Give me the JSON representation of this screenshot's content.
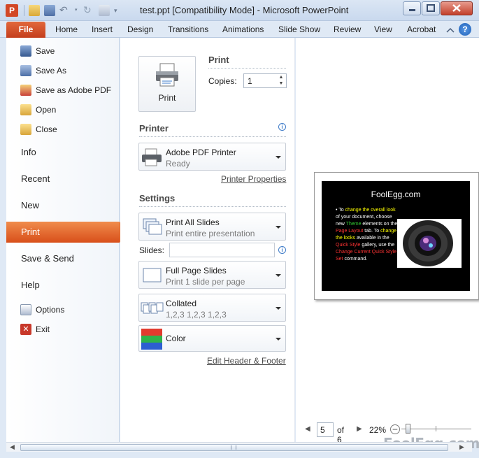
{
  "window": {
    "title": "test.ppt [Compatibility Mode]  -  Microsoft PowerPoint",
    "app_icon_letter": "P"
  },
  "ribbon": {
    "file": "File",
    "tabs": [
      "Home",
      "Insert",
      "Design",
      "Transitions",
      "Animations",
      "Slide Show",
      "Review",
      "View",
      "Acrobat"
    ],
    "help": "?"
  },
  "nav": {
    "commands": [
      "Save",
      "Save As",
      "Save as Adobe PDF",
      "Open",
      "Close"
    ],
    "items": [
      "Info",
      "Recent",
      "New",
      "Print",
      "Save & Send",
      "Help"
    ],
    "bottom_commands": [
      "Options",
      "Exit"
    ],
    "selected": "Print"
  },
  "print": {
    "button_label": "Print",
    "section_title": "Print",
    "copies_label": "Copies:",
    "copies_value": "1"
  },
  "printer": {
    "section_title": "Printer",
    "name": "Adobe PDF Printer",
    "status": "Ready",
    "properties_link": "Printer Properties"
  },
  "settings": {
    "section_title": "Settings",
    "range_title": "Print All Slides",
    "range_sub": "Print entire presentation",
    "slides_label": "Slides:",
    "slides_value": "",
    "layout_title": "Full Page Slides",
    "layout_sub": "Print 1 slide per page",
    "collate_title": "Collated",
    "collate_sub": "1,2,3    1,2,3    1,2,3",
    "color_title": "Color",
    "header_footer_link": "Edit Header & Footer"
  },
  "preview": {
    "slide_title": "FoolEgg.com",
    "slide_body_parts": [
      {
        "t": "To ",
        "c": "#ffffff"
      },
      {
        "t": "change the overall look",
        "c": "#ffff00"
      },
      {
        "t": " of your document, choose new ",
        "c": "#ffffff"
      },
      {
        "t": "Theme",
        "c": "#33cc33"
      },
      {
        "t": " elements on the ",
        "c": "#ffffff"
      },
      {
        "t": "Page Layout",
        "c": "#ff3333"
      },
      {
        "t": " tab. To ",
        "c": "#ffffff"
      },
      {
        "t": "change the looks",
        "c": "#ffff00"
      },
      {
        "t": " available in the ",
        "c": "#ffffff"
      },
      {
        "t": "Quick Style",
        "c": "#ff3333"
      },
      {
        "t": " gallery, use the ",
        "c": "#ffffff"
      },
      {
        "t": "Change Current Quick Style Set",
        "c": "#ff3333"
      },
      {
        "t": " command.",
        "c": "#ffffff"
      }
    ],
    "page_value": "5",
    "page_total": "of 6",
    "zoom": "22%"
  },
  "watermark": "FoolEgg.com",
  "colors": {
    "accent": "#d84f1a",
    "file_tab": "#c43e1c",
    "backstage_bg": "#ffffff"
  }
}
